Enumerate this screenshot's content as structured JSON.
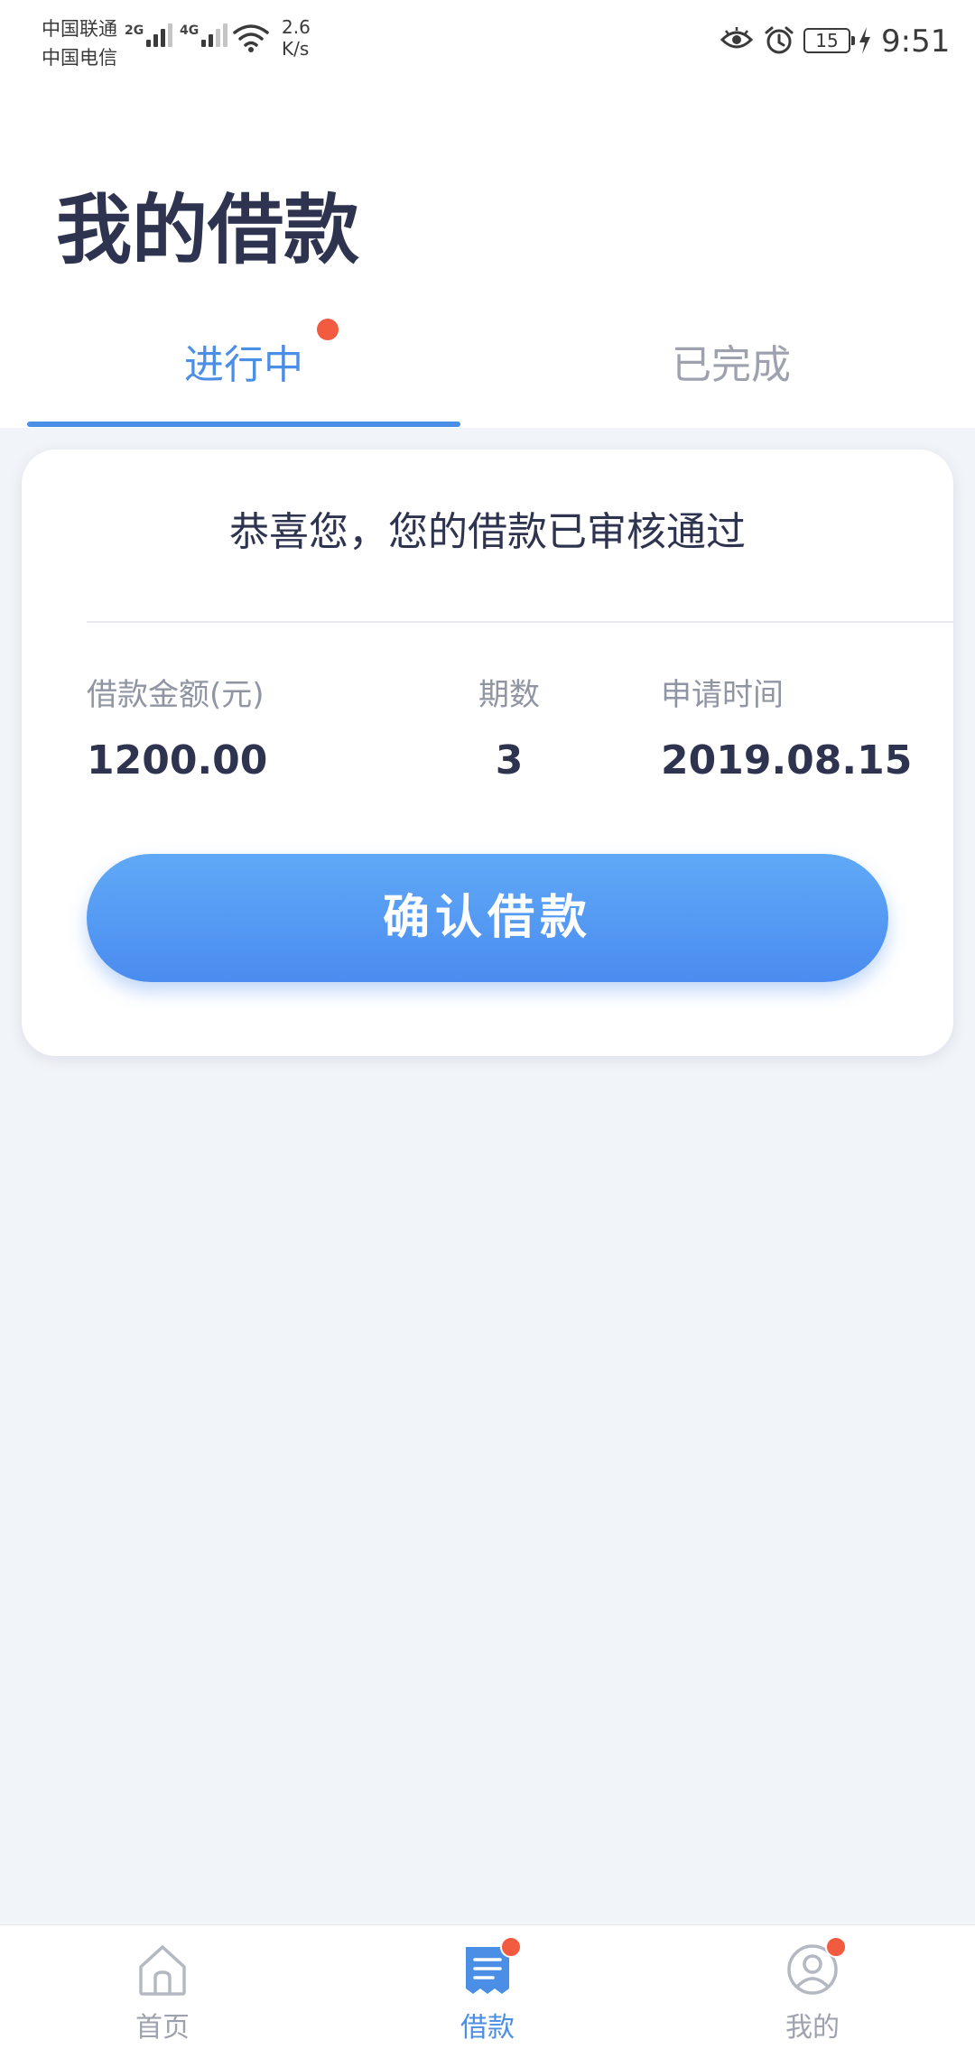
{
  "status_bar": {
    "carrier_1": "中国联通",
    "carrier_2": "中国电信",
    "network_1": "2G",
    "network_2": "4G",
    "speed_value": "2.6",
    "speed_unit": "K/s",
    "battery": "15",
    "time": "9:51"
  },
  "header": {
    "title": "我的借款"
  },
  "tabs": [
    {
      "label": "进行中",
      "active": true,
      "has_badge": true
    },
    {
      "label": "已完成",
      "active": false,
      "has_badge": false
    }
  ],
  "card": {
    "title": "恭喜您，您的借款已审核通过",
    "amount_label": "借款金额(元)",
    "amount_value": "1200.00",
    "periods_label": "期数",
    "periods_value": "3",
    "date_label": "申请时间",
    "date_value": "2019.08.15",
    "confirm_label": "确认借款"
  },
  "bottom_nav": [
    {
      "label": "首页",
      "icon": "home-icon",
      "active": false,
      "has_badge": false
    },
    {
      "label": "借款",
      "icon": "loan-document-icon",
      "active": true,
      "has_badge": true
    },
    {
      "label": "我的",
      "icon": "user-profile-icon",
      "active": false,
      "has_badge": true
    }
  ],
  "colors": {
    "accent": "#4a8ee6",
    "badge": "#f25b40",
    "title_text": "#2e3350",
    "muted_text": "#9da2ae",
    "background": "#f1f4f8"
  }
}
